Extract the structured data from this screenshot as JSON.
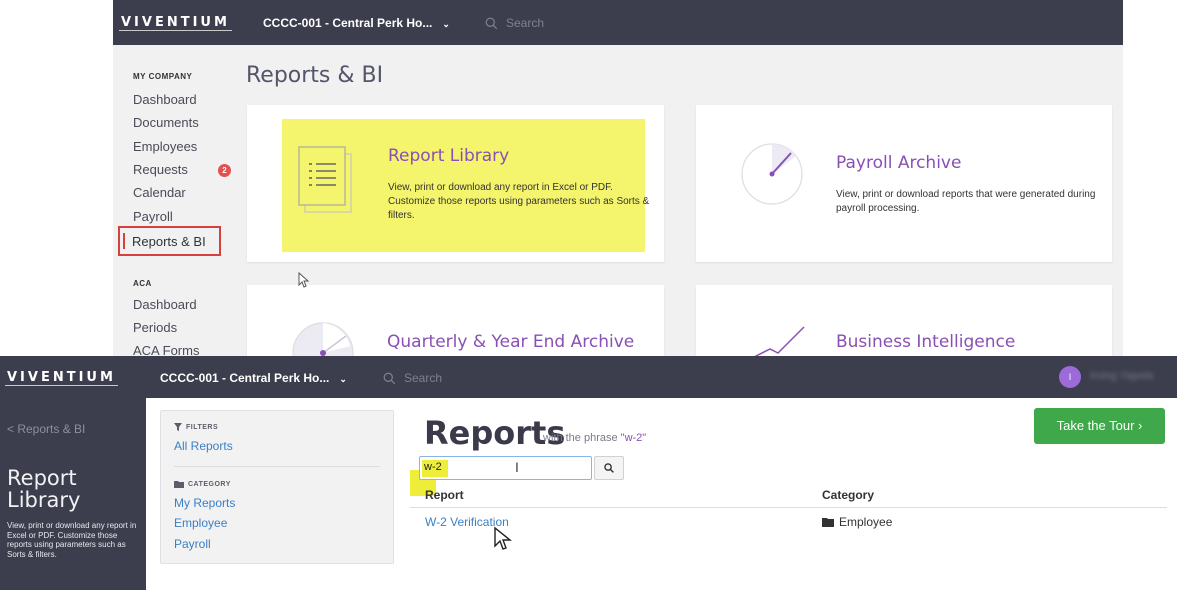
{
  "top_screen": {
    "logo": "VIVENTIUM",
    "company": "CCCC-001 - Central Perk Ho...",
    "search_placeholder": "Search",
    "sidebar": {
      "my_company_heading": "MY COMPANY",
      "items": [
        "Dashboard",
        "Documents",
        "Employees",
        "Requests",
        "Calendar",
        "Payroll",
        "Reports & BI"
      ],
      "requests_badge": "2",
      "aca_heading": "ACA",
      "aca_items": [
        "Dashboard",
        "Periods",
        "ACA Forms"
      ]
    },
    "page_title": "Reports & BI",
    "cards": [
      {
        "title": "Report Library",
        "description": "View, print or download any report in Excel or PDF. Customize those reports using parameters such as Sorts & filters."
      },
      {
        "title": "Payroll Archive",
        "description": "View, print or download reports that were generated during payroll processing."
      },
      {
        "title": "Quarterly & Year End Archive",
        "description": ""
      },
      {
        "title": "Business Intelligence",
        "description": ""
      }
    ],
    "colors": {
      "topbar": "#3c3d4d",
      "accent_purple": "#8a4fb5",
      "highlight_yellow": "#f4f46d",
      "active_red": "#d6413d"
    }
  },
  "bottom_screen": {
    "logo": "VIVENTIUM",
    "company": "CCCC-001 - Central Perk Ho...",
    "search_placeholder": "Search",
    "avatar_initial": "I",
    "user_name": "Irving Yapola",
    "back_link": "< Reports & BI",
    "library_title": "Report Library",
    "library_description": "View, print or download any report in Excel or PDF. Customize those reports using parameters such as Sorts & filters.",
    "filters": {
      "heading": "FILTERS",
      "all_reports": "All Reports",
      "category_heading": "CATEGORY",
      "categories": [
        "My Reports",
        "Employee",
        "Payroll"
      ]
    },
    "reports_heading": "Reports",
    "phrase_prefix": "with the phrase",
    "phrase_value": "\"w-2\"",
    "search_value": "w-2",
    "tour_button": "Take the Tour ›",
    "table": {
      "columns": [
        "Report",
        "Category"
      ],
      "rows": [
        {
          "report": "W-2 Verification",
          "category": "Employee"
        }
      ]
    },
    "colors": {
      "link_blue": "#3b7fc4",
      "tour_green": "#3fa84a"
    }
  }
}
